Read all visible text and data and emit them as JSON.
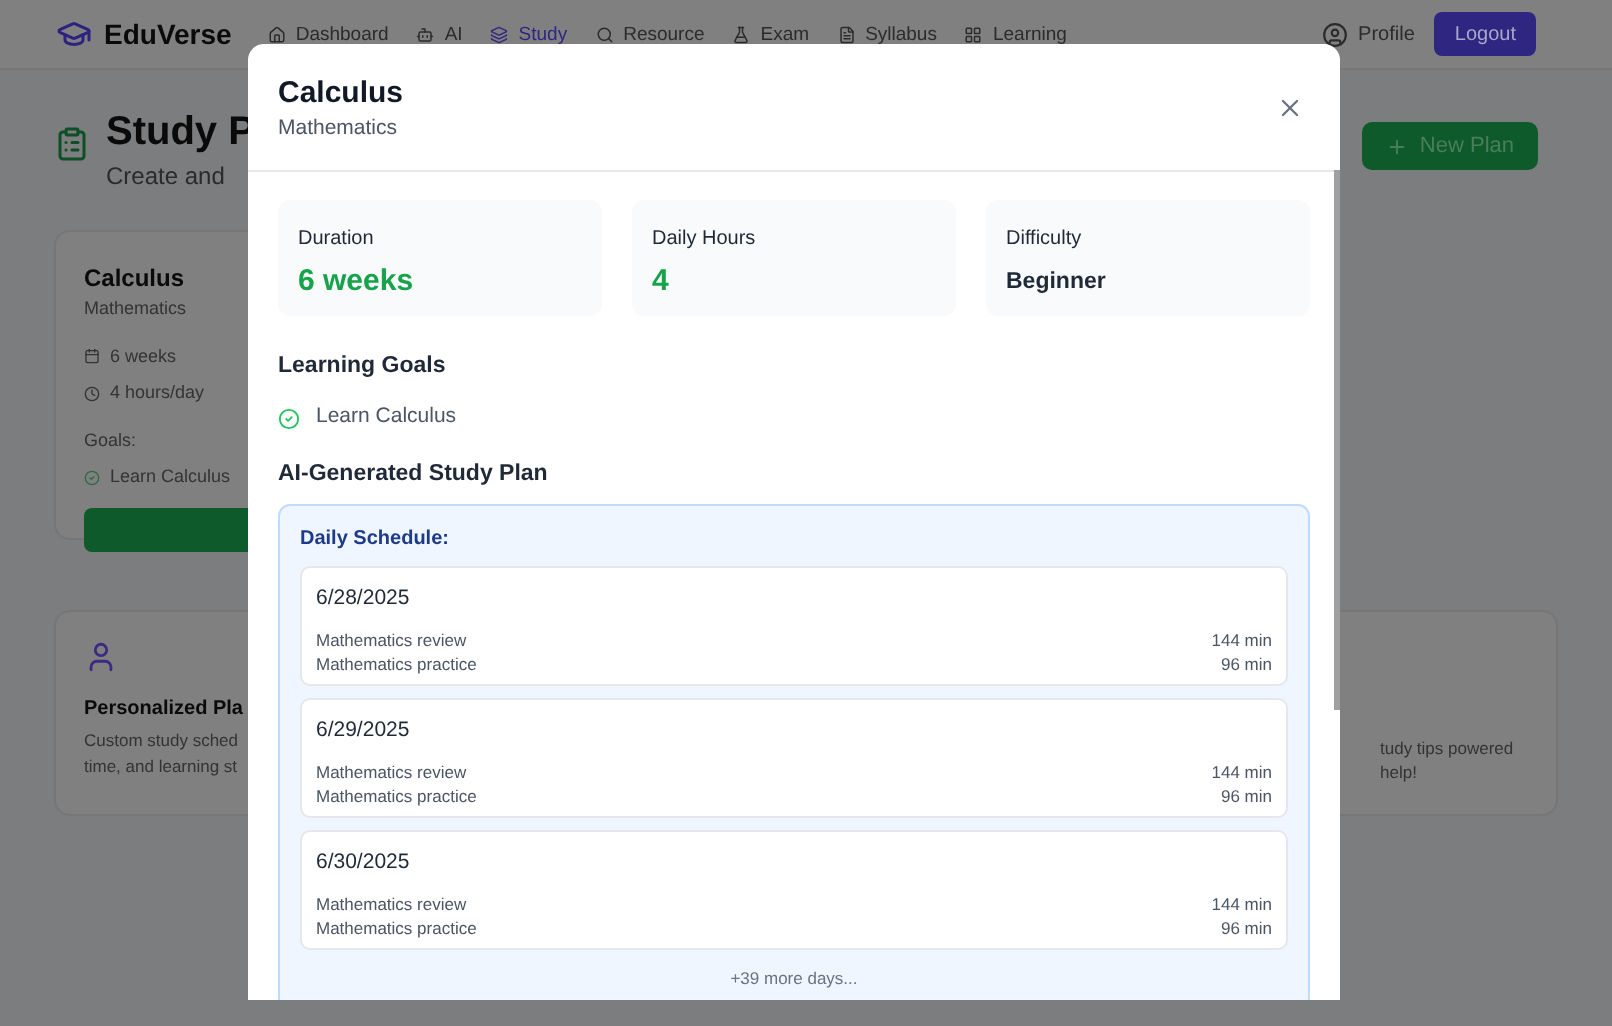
{
  "header": {
    "logo": "EduVerse",
    "nav": [
      {
        "label": "Dashboard",
        "selected": false
      },
      {
        "label": "AI",
        "selected": false
      },
      {
        "label": "Study",
        "selected": true
      },
      {
        "label": "Resource",
        "selected": false
      },
      {
        "label": "Exam",
        "selected": false
      },
      {
        "label": "Syllabus",
        "selected": false
      },
      {
        "label": "Learning",
        "selected": false
      }
    ],
    "profile": "Profile",
    "logout": "Logout"
  },
  "page": {
    "title": "Study P",
    "subtitle": "Create and",
    "new_plan": "New Plan",
    "plan_card": {
      "title": "Calculus",
      "subject": "Mathematics",
      "duration": "6 weeks",
      "hours": "4 hours/day",
      "goals_label": "Goals:",
      "goals": [
        "Learn Calculus"
      ]
    },
    "feature_left": {
      "title": "Personalized Pla",
      "lines": [
        "Custom study sched",
        "time, and learning st"
      ]
    },
    "feature_right": {
      "lines": [
        "tudy tips powered",
        "help!"
      ]
    }
  },
  "modal": {
    "title": "Calculus",
    "subtitle": "Mathematics",
    "stats": [
      {
        "label": "Duration",
        "value": "6 weeks",
        "kind": "highlight"
      },
      {
        "label": "Daily Hours",
        "value": "4",
        "kind": "highlight"
      },
      {
        "label": "Difficulty",
        "value": "Beginner",
        "kind": "plain"
      }
    ],
    "goals_heading": "Learning Goals",
    "goals": [
      "Learn Calculus"
    ],
    "plan_heading": "AI-Generated Study Plan",
    "schedule_label": "Daily Schedule:",
    "days": [
      {
        "date": "6/28/2025",
        "items": [
          {
            "name": "Mathematics review",
            "minutes": "144 min"
          },
          {
            "name": "Mathematics practice",
            "minutes": "96 min"
          }
        ]
      },
      {
        "date": "6/29/2025",
        "items": [
          {
            "name": "Mathematics review",
            "minutes": "144 min"
          },
          {
            "name": "Mathematics practice",
            "minutes": "96 min"
          }
        ]
      },
      {
        "date": "6/30/2025",
        "items": [
          {
            "name": "Mathematics review",
            "minutes": "144 min"
          },
          {
            "name": "Mathematics practice",
            "minutes": "96 min"
          }
        ]
      }
    ],
    "more": "+39 more days..."
  }
}
